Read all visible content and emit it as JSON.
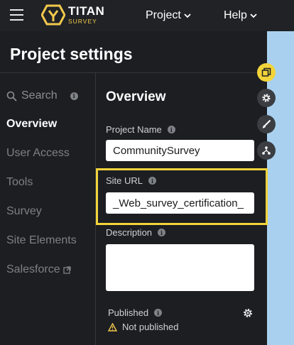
{
  "header": {
    "logo_title": "TITAN",
    "logo_subtitle": "SURVEY",
    "menu": [
      {
        "label": "Project"
      },
      {
        "label": "Help"
      }
    ]
  },
  "page_title": "Project settings",
  "sidebar": {
    "search_placeholder": "Search",
    "items": [
      {
        "label": "Overview",
        "active": true
      },
      {
        "label": "User Access"
      },
      {
        "label": "Tools"
      },
      {
        "label": "Survey"
      },
      {
        "label": "Site Elements"
      },
      {
        "label": "Salesforce",
        "external": true
      }
    ]
  },
  "overview": {
    "title": "Overview",
    "project_name": {
      "label": "Project Name",
      "value": "CommunitySurvey"
    },
    "site_url": {
      "label": "Site URL",
      "value": "_Web_survey_certification_"
    },
    "description": {
      "label": "Description",
      "value": ""
    },
    "published": {
      "label": "Published",
      "status": "Not published"
    }
  },
  "side_tools": [
    {
      "icon": "copy-icon"
    },
    {
      "icon": "gear-icon"
    },
    {
      "icon": "brush-icon"
    },
    {
      "icon": "hierarchy-icon"
    }
  ],
  "colors": {
    "accent_yellow": "#f2d33a",
    "background": "#1c1e22",
    "side_panel": "#a9d1ef"
  }
}
